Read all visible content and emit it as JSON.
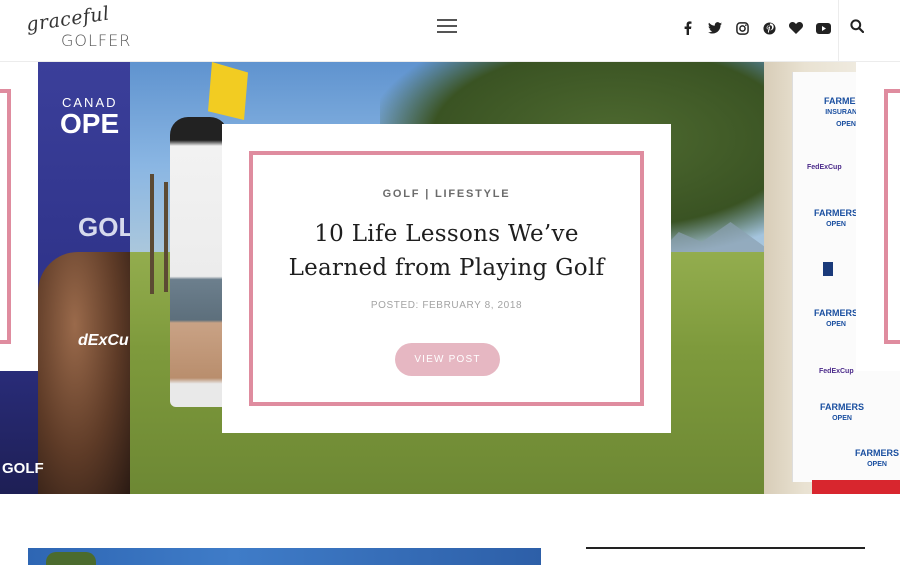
{
  "header": {
    "logo_script": "graceful",
    "logo_word": "GOLFER",
    "menu_icon": "hamburger-menu-icon",
    "social_icons": [
      "facebook-icon",
      "twitter-icon",
      "instagram-icon",
      "pinterest-icon",
      "heart-icon",
      "youtube-icon"
    ],
    "search_icon": "search-icon"
  },
  "hero": {
    "categories": [
      "GOLF",
      "LIFESTYLE"
    ],
    "category_separator": "|",
    "title": "10 Life Lessons We’ve Learned from Playing Golf",
    "posted": "POSTED: FEBRUARY 8, 2018",
    "button_label": "VIEW POST",
    "photo_text": {
      "left_top": "CANAD",
      "left_big": "OPE",
      "left_golf": "GOL",
      "left_fedex": "dExCu",
      "left_bottom": "GOLF",
      "banner_brand": "FARMERS",
      "banner_sub": "INSURANCE",
      "banner_open": "OPEN",
      "banner_fedex": "FedExCup"
    }
  },
  "colors": {
    "accent_pink": "#df8c9f",
    "button_pink": "#e6b7c2"
  }
}
